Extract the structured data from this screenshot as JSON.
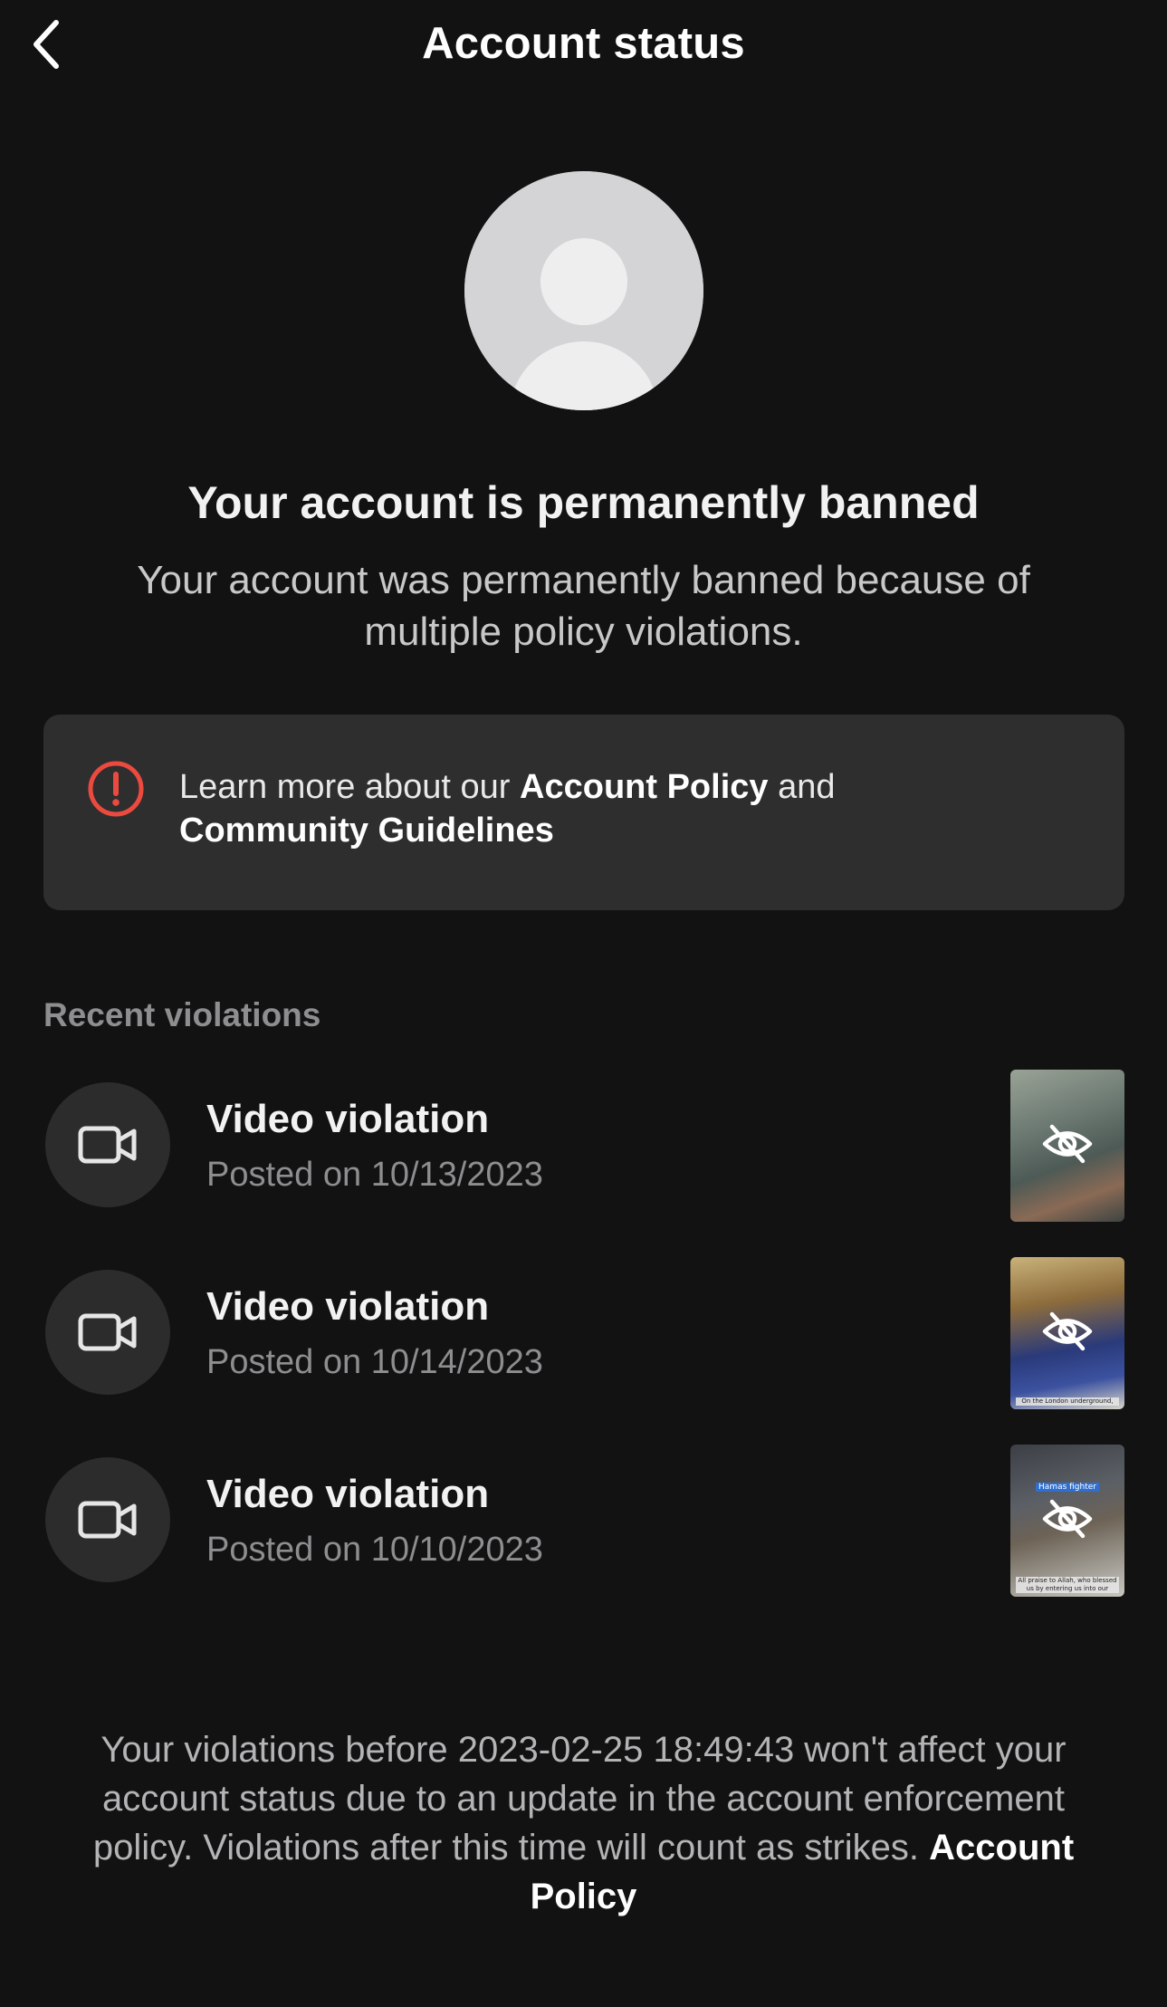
{
  "header": {
    "title": "Account status",
    "back_icon": "chevron-left-icon"
  },
  "avatar": {
    "icon": "default-user-avatar"
  },
  "ban": {
    "title": "Your account is permanently banned",
    "description": "Your account was permanently banned because of multiple policy violations."
  },
  "info_card": {
    "icon": "exclamation-circle-icon",
    "icon_color": "#ec4a3f",
    "text_prefix": "Learn more about our ",
    "link1": "Account Policy",
    "text_middle": " and ",
    "link2": "Community Guidelines"
  },
  "violations": {
    "section_label": "Recent violations",
    "items": [
      {
        "title": "Video violation",
        "date": "Posted on 10/13/2023",
        "icon": "video-camera-icon",
        "thumb_icon": "hidden-eye-icon"
      },
      {
        "title": "Video violation",
        "date": "Posted on 10/14/2023",
        "icon": "video-camera-icon",
        "thumb_icon": "hidden-eye-icon",
        "thumb_caption": "On the London underground,"
      },
      {
        "title": "Video violation",
        "date": "Posted on 10/10/2023",
        "icon": "video-camera-icon",
        "thumb_icon": "hidden-eye-icon",
        "thumb_tag": "Hamas fighter",
        "thumb_caption": "All praise to Allah, who blessed us by entering us into our"
      }
    ]
  },
  "footer": {
    "text": "Your violations before 2023-02-25 18:49:43 won't affect your account status due to an update in the account enforcement policy. Violations after this time will count as strikes. ",
    "link": "Account Policy"
  },
  "colors": {
    "background": "#121212",
    "card": "#2e2e2f",
    "muted_text": "#8e8e90",
    "alert": "#ec4a3f"
  }
}
